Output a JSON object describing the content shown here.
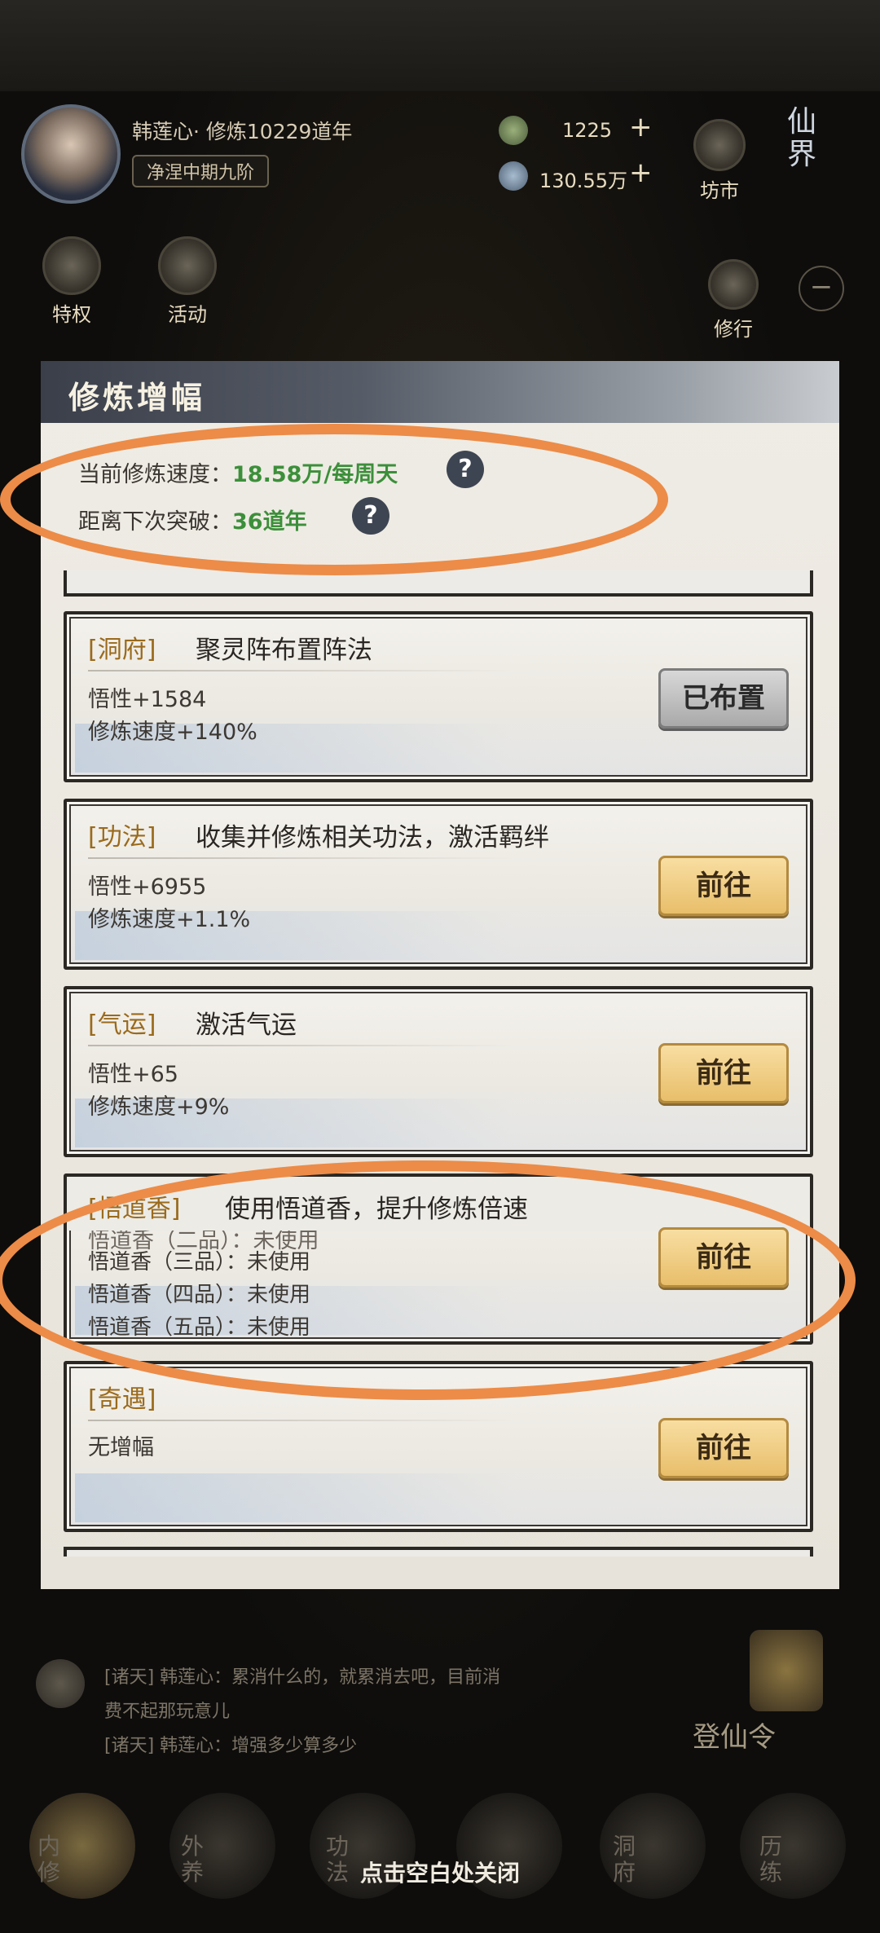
{
  "colors": {
    "accent_orange": "#ec8c48",
    "value_green": "#3c8f3a",
    "tag_brown": "#9a6a1c",
    "button_gold": "#e8be6a"
  },
  "player": {
    "name_line": "韩莲心· 修炼10229道年",
    "realm": "净涅中期九阶"
  },
  "currency": [
    {
      "icon": "spirit-stone-icon",
      "value": "1225"
    },
    {
      "icon": "crystal-icon",
      "value": "130.55万"
    }
  ],
  "top_buttons": {
    "market": "坊市",
    "privilege": "特权",
    "activity": "活动",
    "practice": "修行"
  },
  "realm_badge": "仙界",
  "modal": {
    "title": "修炼增幅",
    "speed_label": "当前修炼速度：",
    "speed_value": "18.58万/每周天",
    "breakthrough_label": "距离下次突破：",
    "breakthrough_value": "36道年",
    "help_glyph": "?"
  },
  "cards": [
    {
      "tag": "[洞府]",
      "title": "聚灵阵布置阵法",
      "lines": [
        "悟性+1584",
        "修炼速度+140%"
      ],
      "button": "已布置"
    },
    {
      "tag": "[功法]",
      "title": "收集并修炼相关功法，激活羁绊",
      "lines": [
        "悟性+6955",
        "修炼速度+1.1%"
      ],
      "button": "前往"
    },
    {
      "tag": "[气运]",
      "title": "激活气运",
      "lines": [
        "悟性+65",
        "修炼速度+9%"
      ],
      "button": "前往"
    },
    {
      "tag": "[悟道香]",
      "title": "使用悟道香，提升修炼倍速",
      "lines": [
        "悟道香（二品）：未使用",
        "悟道香（三品）：未使用",
        "悟道香（四品）：未使用",
        "悟道香（五品）：未使用"
      ],
      "button": "前往"
    },
    {
      "tag": "[奇遇]",
      "title": "",
      "lines": [
        "无增幅"
      ],
      "button": "前往"
    }
  ],
  "chat": [
    "[诸天] 韩莲心：累消什么的，就累消去吧，目前消",
    "费不起那玩意儿",
    "[诸天] 韩莲心：增强多少算多少"
  ],
  "dengxian": "登仙令",
  "nav": [
    "内修",
    "外养",
    "功法",
    "",
    "洞府",
    "历练"
  ],
  "close_hint": "点击空白处关闭"
}
